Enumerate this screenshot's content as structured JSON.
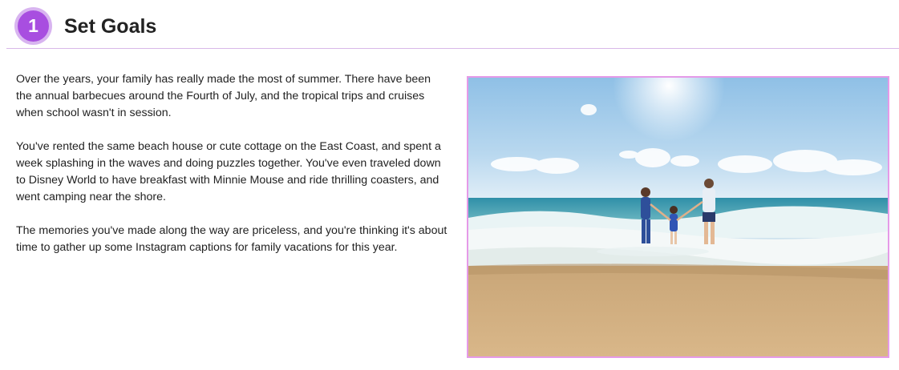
{
  "section": {
    "step_number": "1",
    "title": "Set Goals"
  },
  "paragraphs": [
    "Over the years, your family has really made the most of summer. There have been the annual barbecues around the Fourth of July, and the tropical trips and cruises when school wasn't in session.",
    "You've rented the same beach house or cute cottage on the East Coast, and spent a week splashing in the waves and doing puzzles together. You've even traveled down to Disney World to have breakfast with Minnie Mouse and ride thrilling coasters, and went camping near the shore.",
    "The memories you've made along the way are priceless, and you're thinking it's about time to gather up some Instagram captions for family vacations for this year."
  ],
  "colors": {
    "accent": "#a84ee0",
    "accent_light": "#d8b4f0",
    "divider": "#d9b8e8",
    "photo_border": "#e59ae8"
  }
}
